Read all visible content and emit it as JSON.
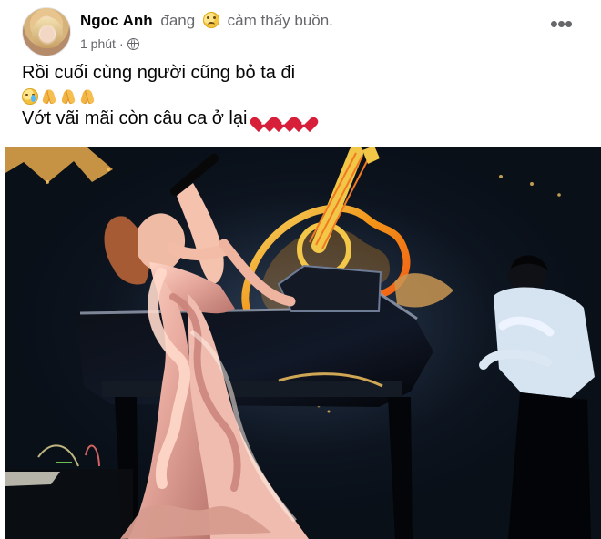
{
  "post": {
    "author_name": "Ngoc Anh",
    "feeling_prefix": "đang",
    "feeling_text": "cảm thấy buồn.",
    "timestamp": "1 phút",
    "separator": "·",
    "privacy_icon": "globe-icon",
    "more_label": "•••",
    "text_lines": [
      "Rồi cuối cùng người cũng bỏ ta đi",
      "Vớt vãi mãi còn câu ca ở lại"
    ],
    "emoji_icons": [
      "crying-face-icon",
      "praying-hands-icon",
      "praying-hands-icon",
      "praying-hands-icon",
      "broken-heart-icon",
      "broken-heart-icon",
      "broken-heart-icon"
    ]
  },
  "colors": {
    "author": "#050505",
    "secondary_text": "#65676b",
    "post_background": "#ffffff",
    "broken_heart": "#d81f3a",
    "stage_background": "#0b1320",
    "guitar_glow": "#ffbf24",
    "dress": "#e7a99d"
  },
  "image": {
    "subject_icons": [
      "singer-figure",
      "microphone-icon",
      "guitar-stage-art",
      "grand-piano",
      "pianist-figure"
    ]
  }
}
